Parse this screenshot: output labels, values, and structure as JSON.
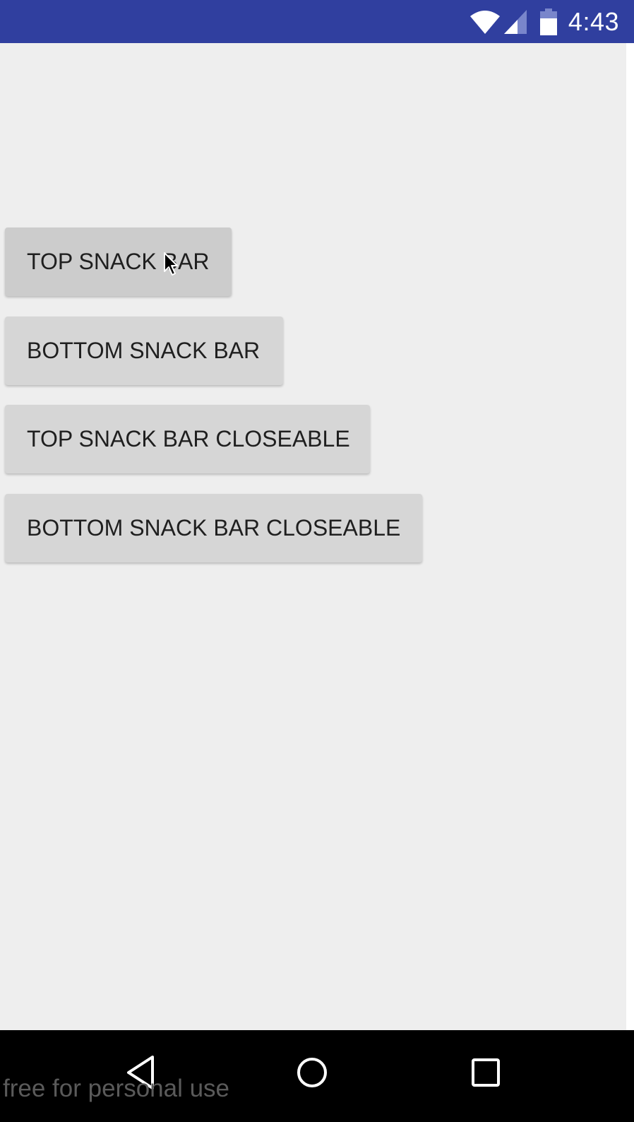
{
  "status_bar": {
    "time": "4:43",
    "icons": [
      "wifi-icon",
      "signal-icon",
      "battery-icon"
    ],
    "background_color": "#303f9f"
  },
  "buttons": [
    {
      "label": "TOP SNACK BAR"
    },
    {
      "label": "BOTTOM SNACK BAR"
    },
    {
      "label": "TOP SNACK BAR CLOSEABLE"
    },
    {
      "label": "BOTTOM SNACK BAR CLOSEABLE"
    }
  ],
  "navigation_bar": {
    "icons": [
      "back-icon",
      "home-icon",
      "recents-icon"
    ]
  },
  "watermark": "free for personal use",
  "colors": {
    "background": "#eeeeee",
    "button": "#d6d6d6",
    "button_text": "#1f1f1f",
    "nav_bar": "#000000"
  }
}
